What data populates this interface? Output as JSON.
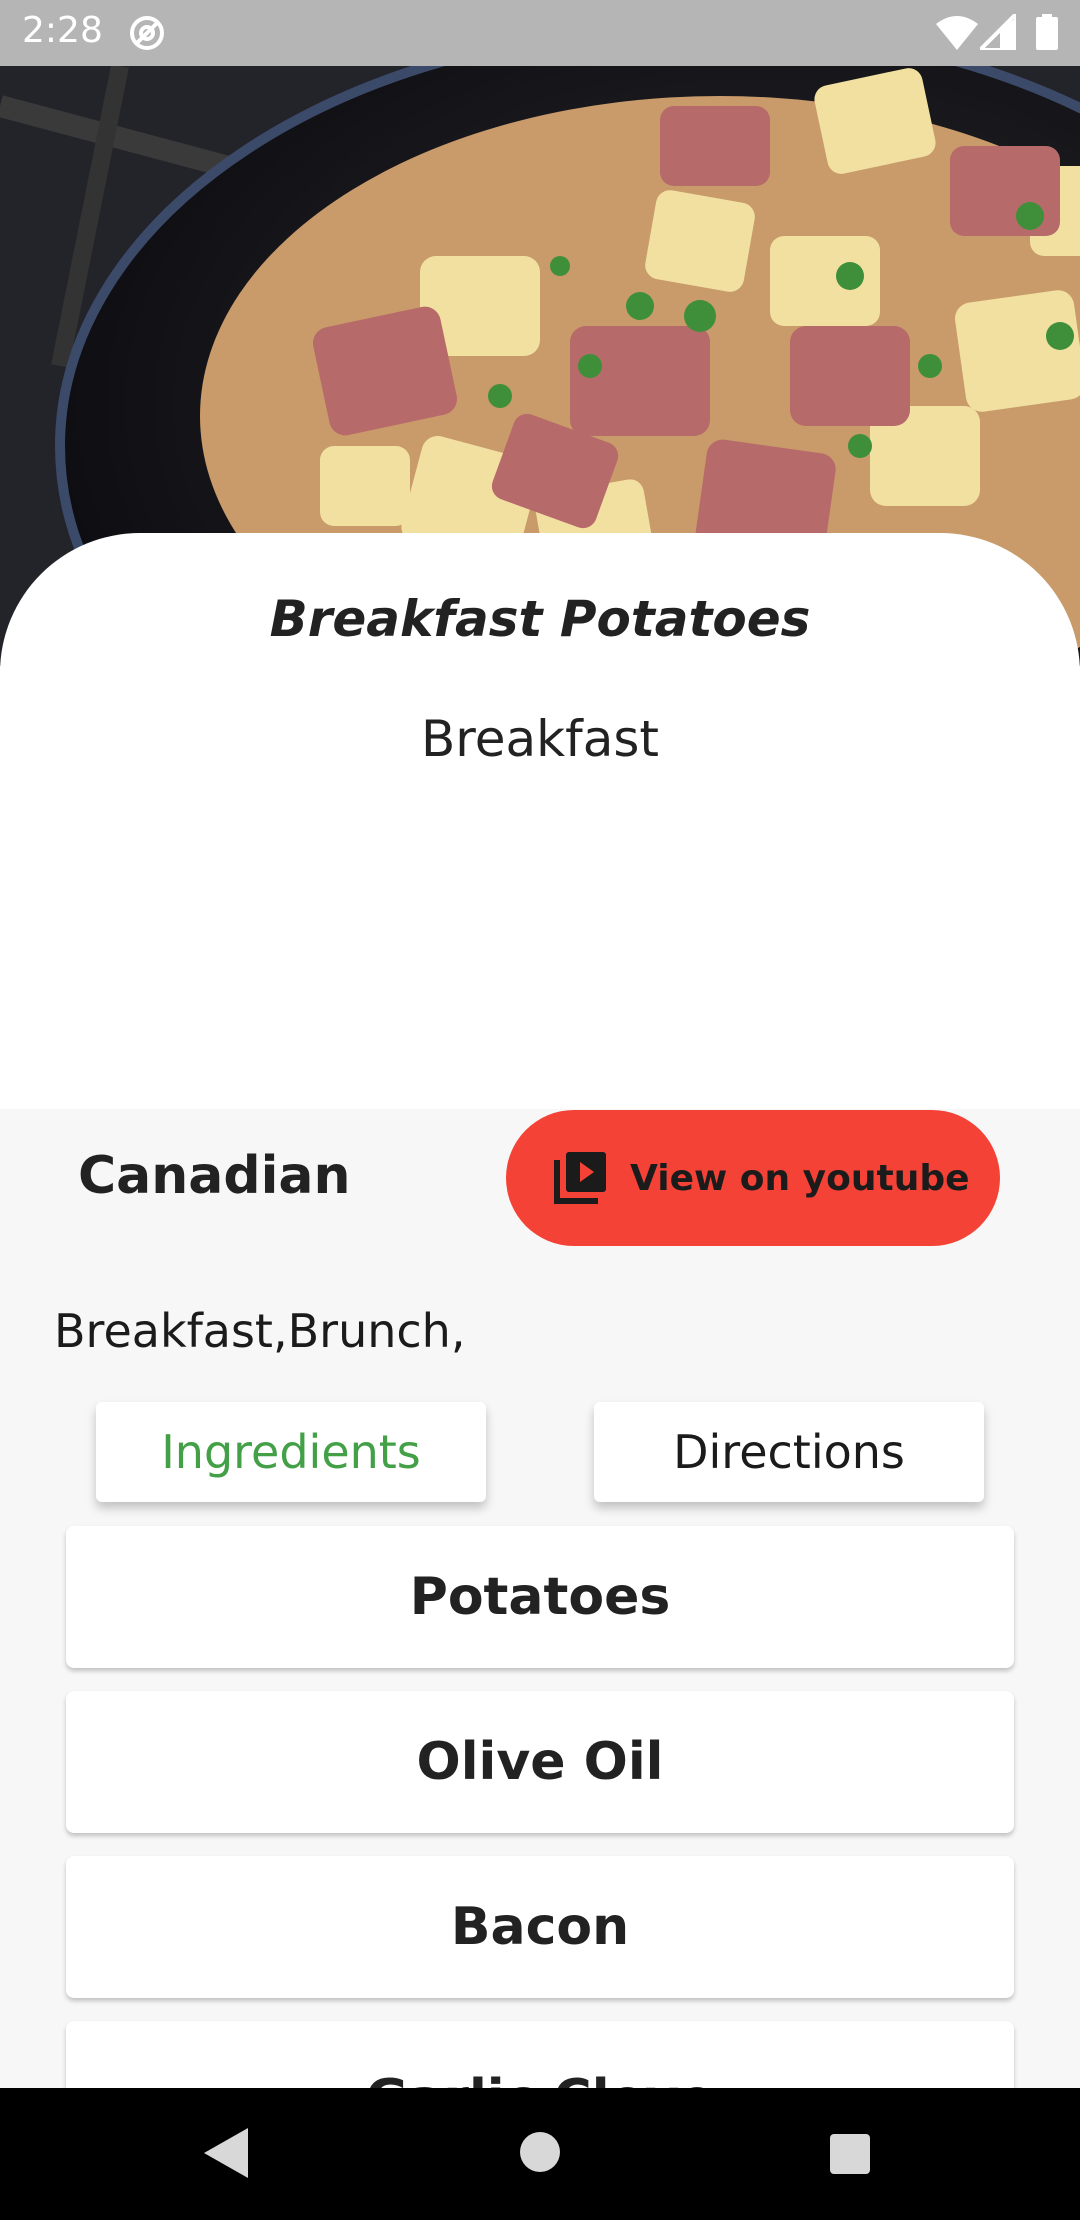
{
  "status_bar": {
    "time": "2:28",
    "icons": [
      "at-sign-icon",
      "wifi-icon",
      "cell-signal-icon",
      "battery-icon"
    ]
  },
  "hero": {
    "image": "breakfast-potatoes-skillet-photo"
  },
  "meal": {
    "title": "Breakfast Potatoes",
    "category": "Breakfast",
    "area": "Canadian",
    "tags": "Breakfast,Brunch,"
  },
  "youtube_button": {
    "label": "View on youtube",
    "icon": "video-library-icon",
    "color": "#f44336"
  },
  "tabs": [
    {
      "label": "Ingredients",
      "active": true,
      "color": "#43a047"
    },
    {
      "label": "Directions",
      "active": false
    }
  ],
  "ingredients": [
    "Potatoes",
    "Olive Oil",
    "Bacon",
    "Garlic Clove"
  ],
  "nav_bar": {
    "icons": [
      "back-icon",
      "home-icon",
      "recents-icon"
    ]
  }
}
